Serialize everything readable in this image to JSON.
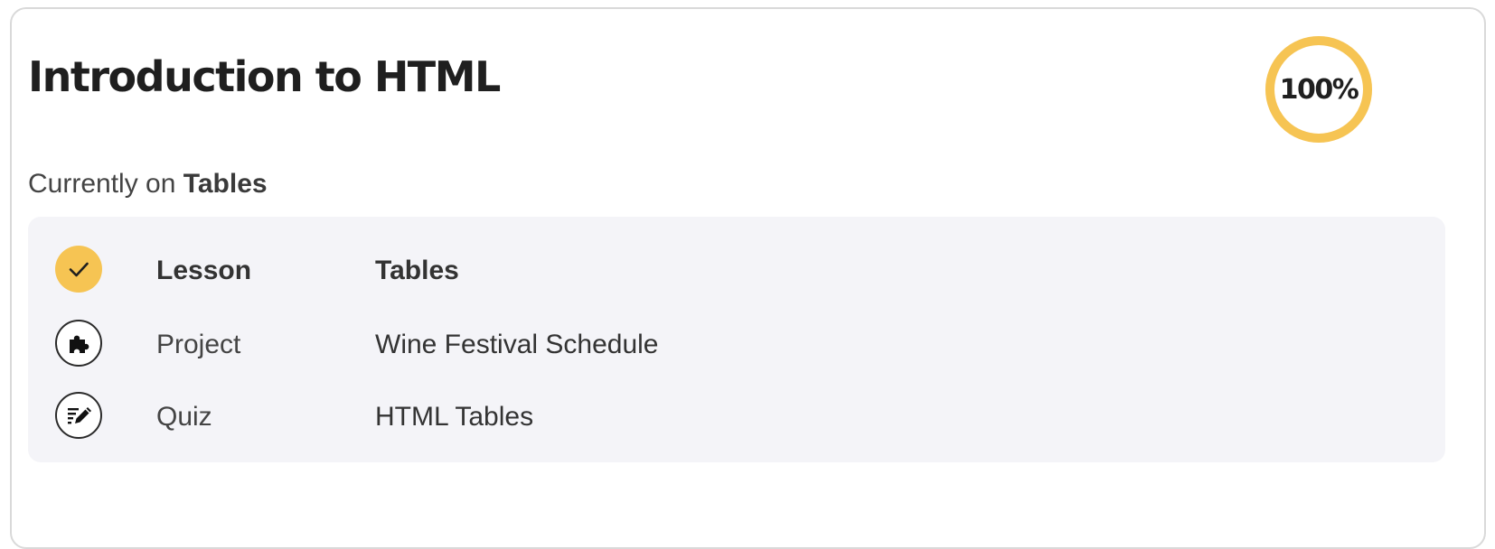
{
  "course": {
    "title": "Introduction to HTML",
    "progress_label": "100%",
    "progress_value": 1.0,
    "accent_color": "#f6c453"
  },
  "status": {
    "prefix": "Currently on",
    "current_item": "Tables"
  },
  "steps": [
    {
      "type": "Lesson",
      "title": "Tables",
      "icon": "checkmark-icon",
      "completed": true
    },
    {
      "type": "Project",
      "title": "Wine Festival Schedule",
      "icon": "puzzle-icon",
      "completed": false
    },
    {
      "type": "Quiz",
      "title": "HTML Tables",
      "icon": "quiz-pencil-icon",
      "completed": false
    }
  ]
}
